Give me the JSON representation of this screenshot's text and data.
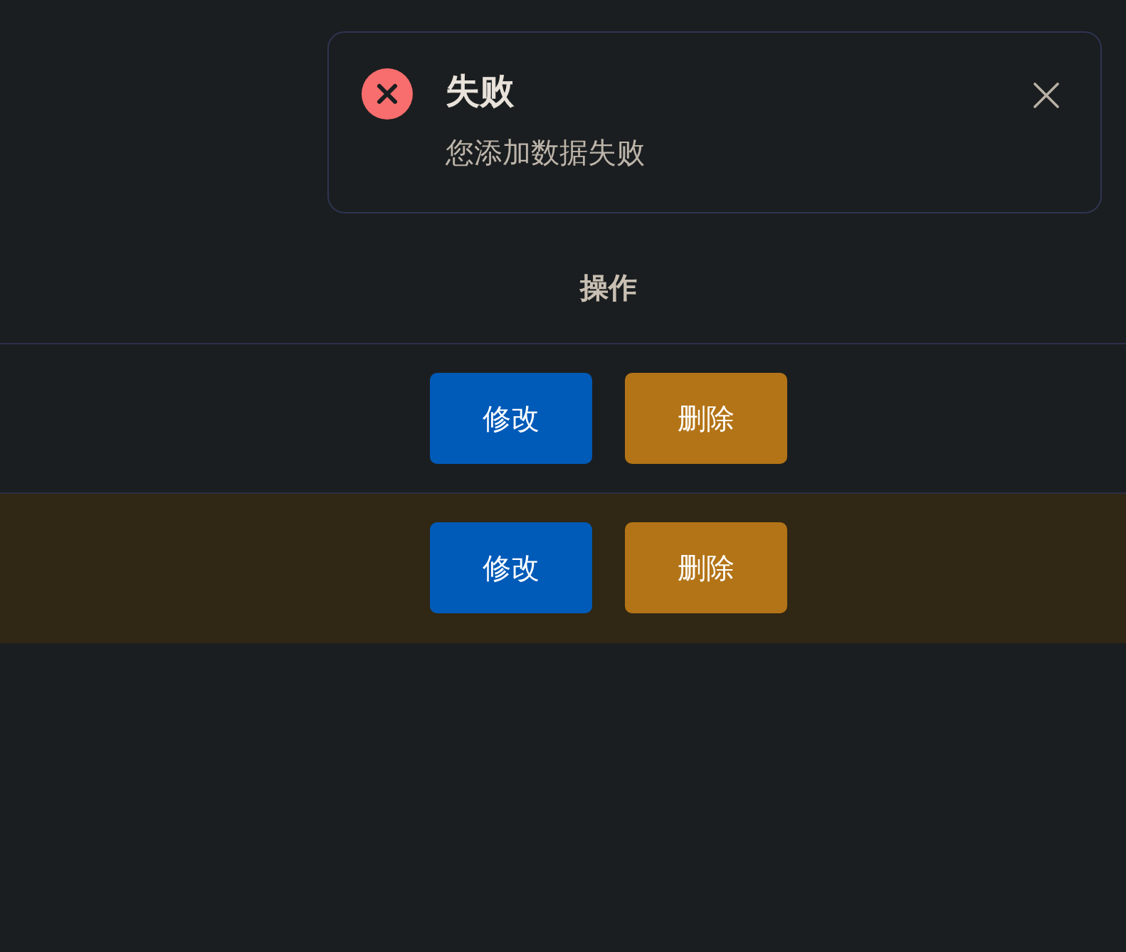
{
  "notification": {
    "kind": "error",
    "title": "失败",
    "message": "您添加数据失败"
  },
  "table": {
    "columns": [
      "操作"
    ],
    "rows": [
      {
        "selected": false,
        "actions": [
          {
            "kind": "edit",
            "label": "修改"
          },
          {
            "kind": "delete",
            "label": "删除"
          }
        ]
      },
      {
        "selected": true,
        "actions": [
          {
            "kind": "edit",
            "label": "修改"
          },
          {
            "kind": "delete",
            "label": "删除"
          }
        ]
      }
    ]
  }
}
